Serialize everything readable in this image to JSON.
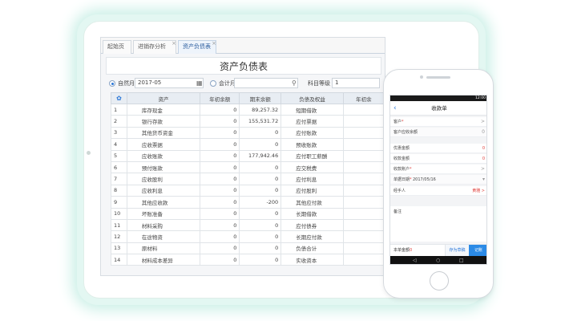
{
  "tabs": [
    {
      "label": "起始页"
    },
    {
      "label": "进销存分析",
      "close": "×"
    },
    {
      "label": "资产负债表",
      "close": "×"
    }
  ],
  "report": {
    "title": "资产负债表",
    "filter": {
      "natural_month_label": "自然月",
      "natural_month_value": "2017-05",
      "accounting_month_label": "会计月",
      "subject_level_label": "科目等级",
      "subject_level_value": "1"
    },
    "columns": [
      "资产",
      "年初余额",
      "期末余额",
      "负债及权益",
      "年初余"
    ],
    "rows": [
      {
        "idx": "1",
        "asset": "库存现金",
        "begin": "0",
        "end": "89,257.32",
        "liab": "短期借款"
      },
      {
        "idx": "2",
        "asset": "银行存款",
        "begin": "0",
        "end": "155,531.72",
        "liab": "应付票据"
      },
      {
        "idx": "3",
        "asset": "其他货币资金",
        "begin": "0",
        "end": "0",
        "liab": "应付账款"
      },
      {
        "idx": "4",
        "asset": "应收票据",
        "begin": "0",
        "end": "0",
        "liab": "预收账款"
      },
      {
        "idx": "5",
        "asset": "应收账款",
        "begin": "0",
        "end": "177,942.46",
        "liab": "应付职工薪酬"
      },
      {
        "idx": "6",
        "asset": "预付账款",
        "begin": "0",
        "end": "0",
        "liab": "应交税费"
      },
      {
        "idx": "7",
        "asset": "应收股利",
        "begin": "0",
        "end": "0",
        "liab": "应付利息"
      },
      {
        "idx": "8",
        "asset": "应收利息",
        "begin": "0",
        "end": "0",
        "liab": "应付股利"
      },
      {
        "idx": "9",
        "asset": "其他应收款",
        "begin": "0",
        "end": "-200",
        "liab": "其他应付款"
      },
      {
        "idx": "10",
        "asset": "坏账准备",
        "begin": "0",
        "end": "0",
        "liab": "长期借款"
      },
      {
        "idx": "11",
        "asset": "材料采购",
        "begin": "0",
        "end": "0",
        "liab": "应付债券"
      },
      {
        "idx": "12",
        "asset": "在途物资",
        "begin": "0",
        "end": "0",
        "liab": "长期应付款"
      },
      {
        "idx": "13",
        "asset": "原材料",
        "begin": "0",
        "end": "0",
        "liab": "负债合计"
      },
      {
        "idx": "14",
        "asset": "材料成本差异",
        "begin": "0",
        "end": "0",
        "liab": "实收资本"
      }
    ]
  },
  "phone": {
    "status_right": "12:00",
    "title": "收款单",
    "fields": [
      {
        "label": "客户",
        "required": "*",
        "right": ">",
        "right_class": ""
      },
      {
        "label": "客户应收余额",
        "right": "0",
        "right_class": ""
      },
      {
        "label": "优惠金额",
        "right": "0",
        "right_class": "red"
      },
      {
        "label": "收款金额",
        "right": "0",
        "right_class": "red"
      },
      {
        "label": "收款账户",
        "required": "*",
        "right": ">",
        "right_class": ""
      },
      {
        "label": "单据日期",
        "required": "*",
        "value": "2017/05/16",
        "right": "▾",
        "right_class": ""
      },
      {
        "label": "经手人",
        "right": "黄雅 >",
        "right_class": "red"
      }
    ],
    "note_label": "备注",
    "bottom": {
      "amount_label": "本单金额",
      "amount_value": "0",
      "draft": "存为草稿",
      "save": "记账"
    }
  },
  "colors": {
    "accent": "#2b77d8",
    "required": "#e0403c",
    "glow": "#c9efe6"
  }
}
